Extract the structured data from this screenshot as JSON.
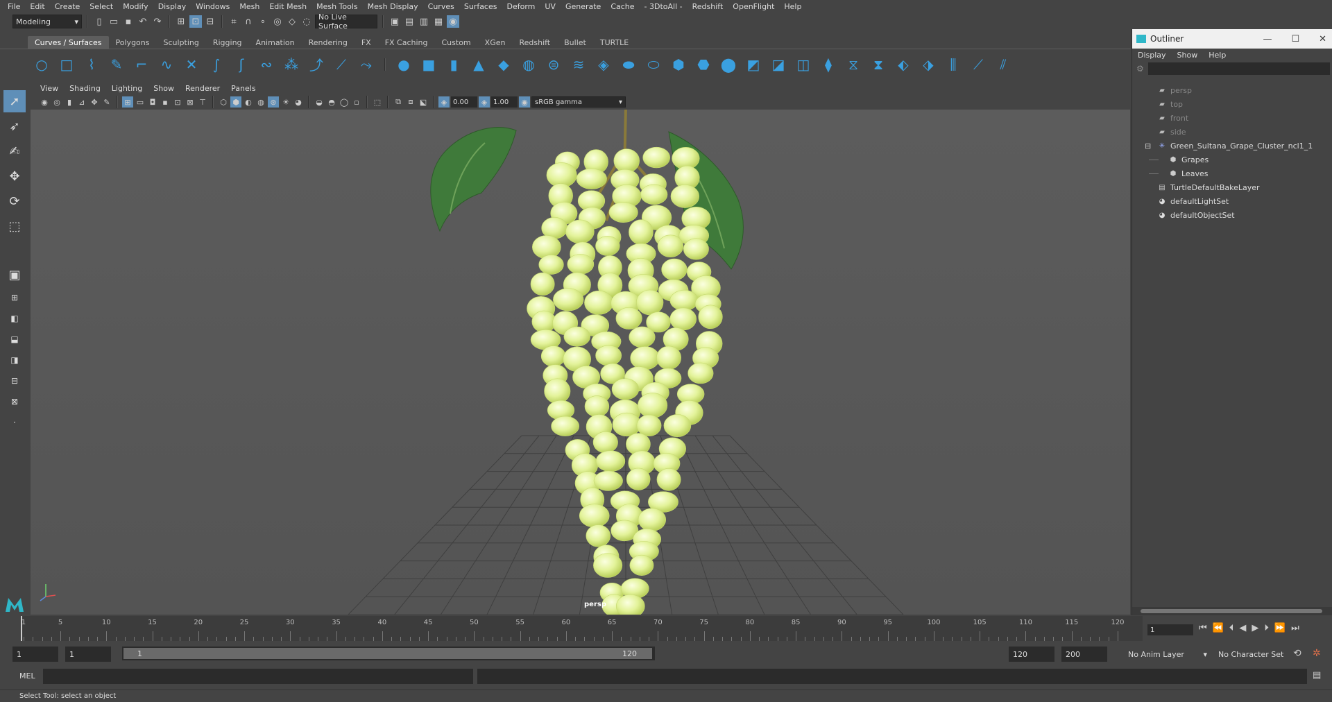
{
  "menubar": [
    "File",
    "Edit",
    "Create",
    "Select",
    "Modify",
    "Display",
    "Windows",
    "Mesh",
    "Edit Mesh",
    "Mesh Tools",
    "Mesh Display",
    "Curves",
    "Surfaces",
    "Deform",
    "UV",
    "Generate",
    "Cache",
    "- 3DtoAll -",
    "Redshift",
    "OpenFlight",
    "Help"
  ],
  "statusline": {
    "workspace": "Modeling",
    "live_surface": "No Live Surface"
  },
  "shelf_tabs": [
    "Curves / Surfaces",
    "Polygons",
    "Sculpting",
    "Rigging",
    "Animation",
    "Rendering",
    "FX",
    "FX Caching",
    "Custom",
    "XGen",
    "Redshift",
    "Bullet",
    "TURTLE"
  ],
  "active_shelf_tab": "Curves / Surfaces",
  "viewport": {
    "menu": [
      "View",
      "Shading",
      "Lighting",
      "Show",
      "Renderer",
      "Panels"
    ],
    "exposure": "0.00",
    "gamma": "1.00",
    "color_space": "sRGB gamma",
    "camera_label": "persp"
  },
  "outliner": {
    "title": "Outliner",
    "menu": [
      "Display",
      "Show",
      "Help"
    ],
    "items": [
      {
        "label": "persp",
        "icon": "camera-icon",
        "dim": true
      },
      {
        "label": "top",
        "icon": "camera-icon",
        "dim": true
      },
      {
        "label": "front",
        "icon": "camera-icon",
        "dim": true
      },
      {
        "label": "side",
        "icon": "camera-icon",
        "dim": true
      },
      {
        "label": "Green_Sultana_Grape_Cluster_ncl1_1",
        "icon": "group-icon",
        "dim": false
      },
      {
        "label": "Grapes",
        "icon": "mesh-icon",
        "dim": false
      },
      {
        "label": "Leaves",
        "icon": "mesh-icon",
        "dim": false
      },
      {
        "label": "TurtleDefaultBakeLayer",
        "icon": "layer-icon",
        "dim": false
      },
      {
        "label": "defaultLightSet",
        "icon": "set-icon",
        "dim": false
      },
      {
        "label": "defaultObjectSet",
        "icon": "set-icon",
        "dim": false
      }
    ]
  },
  "timeline": {
    "ticks": [
      "1",
      "5",
      "10",
      "15",
      "20",
      "25",
      "30",
      "35",
      "40",
      "45",
      "50",
      "55",
      "60",
      "65",
      "70",
      "75",
      "80",
      "85",
      "90",
      "95",
      "100",
      "105",
      "110",
      "115",
      "120"
    ],
    "current_frame": "1"
  },
  "range": {
    "start_frame": "1",
    "playback_start": "1",
    "slider_start": "1",
    "slider_end": "120",
    "playback_end": "120",
    "end_frame": "200",
    "anim_layer": "No Anim Layer",
    "character_set": "No Character Set"
  },
  "cmdline": {
    "label": "MEL"
  },
  "helpline": "Select Tool: select an object",
  "colors": {
    "accent": "#5f8fb8",
    "grape": "#e8f5a0",
    "leaf": "#3f7a3a"
  }
}
